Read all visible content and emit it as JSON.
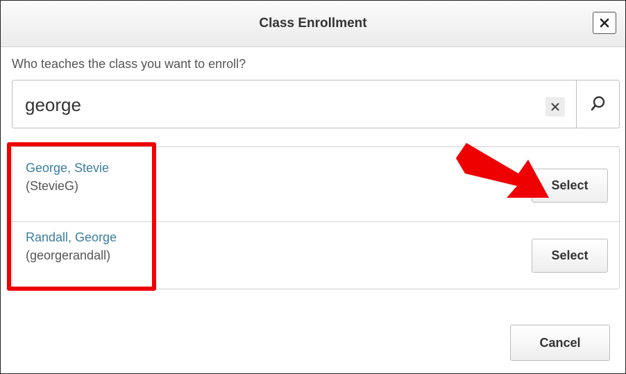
{
  "dialog": {
    "title": "Class Enrollment",
    "close_icon": "close-icon"
  },
  "search": {
    "prompt": "Who teaches the class you want to enroll?",
    "value": "george",
    "clear_icon": "clear-x-icon",
    "search_icon": "magnifier-icon"
  },
  "results": [
    {
      "name": "George, Stevie",
      "username": "(StevieG)",
      "select_label": "Select"
    },
    {
      "name": "Randall, George",
      "username": "(georgerandall)",
      "select_label": "Select"
    }
  ],
  "footer": {
    "cancel_label": "Cancel"
  },
  "annotations": {
    "highlight_color": "#ee0000",
    "arrow_color": "#ee0000"
  }
}
